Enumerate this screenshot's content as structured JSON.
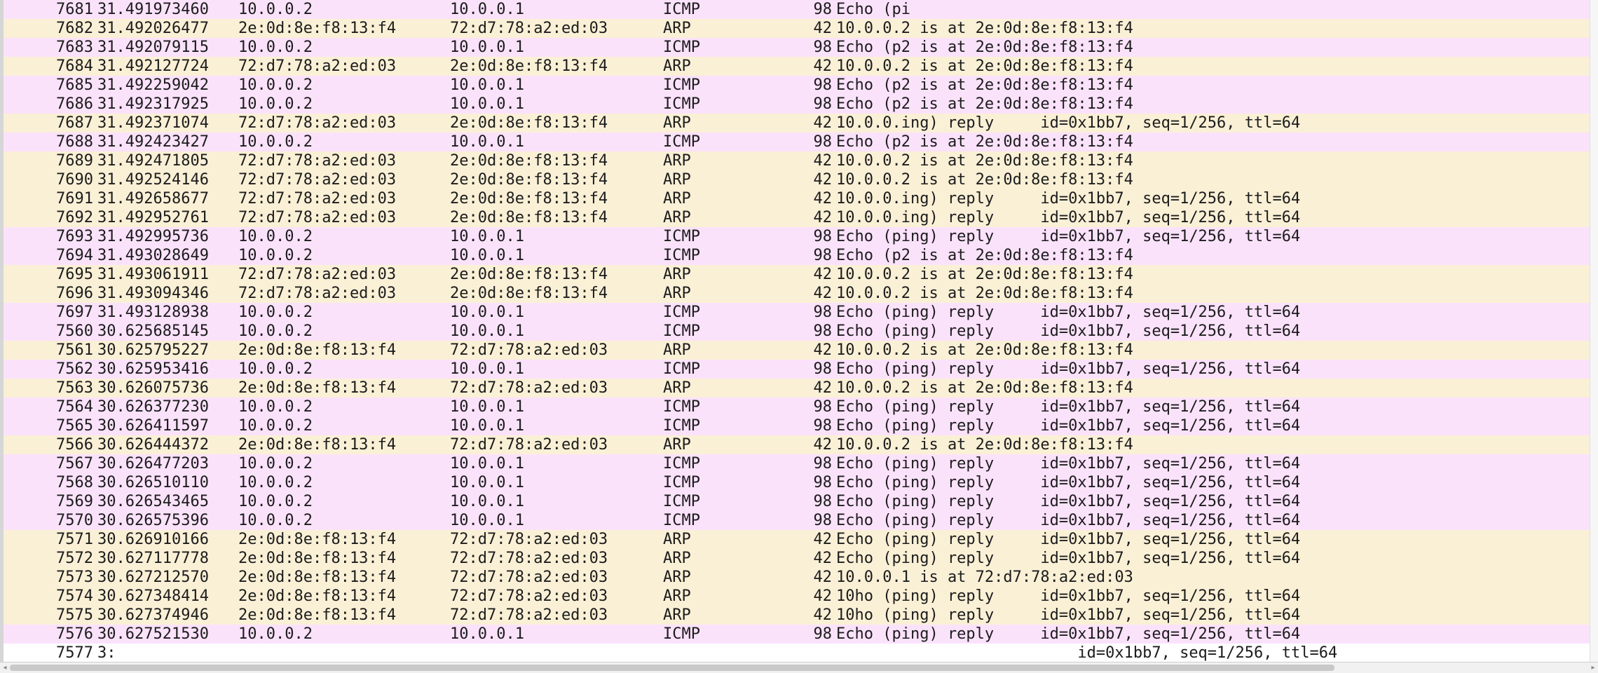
{
  "packets": [
    {
      "no": "7681",
      "time": "31.491973460",
      "src": "10.0.0.2",
      "dst": "10.0.0.1",
      "proto": "ICMP",
      "len": "98",
      "info": "Echo (pi",
      "proto_class": "icmp"
    },
    {
      "no": "7682",
      "time": "31.492026477",
      "src": "2e:0d:8e:f8:13:f4",
      "dst": "72:d7:78:a2:ed:03",
      "proto": "ARP",
      "len": "42",
      "info": "10.0.0.2 is at 2e:0d:8e:f8:13:f4",
      "proto_class": "arp"
    },
    {
      "no": "7683",
      "time": "31.492079115",
      "src": "10.0.0.2",
      "dst": "10.0.0.1",
      "proto": "ICMP",
      "len": "98",
      "info": "Echo (p2 is at 2e:0d:8e:f8:13:f4",
      "proto_class": "icmp"
    },
    {
      "no": "7684",
      "time": "31.492127724",
      "src": "72:d7:78:a2:ed:03",
      "dst": "2e:0d:8e:f8:13:f4",
      "proto": "ARP",
      "len": "42",
      "info": "10.0.0.2 is at 2e:0d:8e:f8:13:f4",
      "proto_class": "arp"
    },
    {
      "no": "7685",
      "time": "31.492259042",
      "src": "10.0.0.2",
      "dst": "10.0.0.1",
      "proto": "ICMP",
      "len": "98",
      "info": "Echo (p2 is at 2e:0d:8e:f8:13:f4",
      "proto_class": "icmp"
    },
    {
      "no": "7686",
      "time": "31.492317925",
      "src": "10.0.0.2",
      "dst": "10.0.0.1",
      "proto": "ICMP",
      "len": "98",
      "info": "Echo (p2 is at 2e:0d:8e:f8:13:f4",
      "proto_class": "icmp"
    },
    {
      "no": "7687",
      "time": "31.492371074",
      "src": "72:d7:78:a2:ed:03",
      "dst": "2e:0d:8e:f8:13:f4",
      "proto": "ARP",
      "len": "42",
      "info": "10.0.0.ing) reply     id=0x1bb7, seq=1/256, ttl=64",
      "proto_class": "arp"
    },
    {
      "no": "7688",
      "time": "31.492423427",
      "src": "10.0.0.2",
      "dst": "10.0.0.1",
      "proto": "ICMP",
      "len": "98",
      "info": "Echo (p2 is at 2e:0d:8e:f8:13:f4",
      "proto_class": "icmp"
    },
    {
      "no": "7689",
      "time": "31.492471805",
      "src": "72:d7:78:a2:ed:03",
      "dst": "2e:0d:8e:f8:13:f4",
      "proto": "ARP",
      "len": "42",
      "info": "10.0.0.2 is at 2e:0d:8e:f8:13:f4",
      "proto_class": "arp"
    },
    {
      "no": "7690",
      "time": "31.492524146",
      "src": "72:d7:78:a2:ed:03",
      "dst": "2e:0d:8e:f8:13:f4",
      "proto": "ARP",
      "len": "42",
      "info": "10.0.0.2 is at 2e:0d:8e:f8:13:f4",
      "proto_class": "arp"
    },
    {
      "no": "7691",
      "time": "31.492658677",
      "src": "72:d7:78:a2:ed:03",
      "dst": "2e:0d:8e:f8:13:f4",
      "proto": "ARP",
      "len": "42",
      "info": "10.0.0.ing) reply     id=0x1bb7, seq=1/256, ttl=64",
      "proto_class": "arp"
    },
    {
      "no": "7692",
      "time": "31.492952761",
      "src": "72:d7:78:a2:ed:03",
      "dst": "2e:0d:8e:f8:13:f4",
      "proto": "ARP",
      "len": "42",
      "info": "10.0.0.ing) reply     id=0x1bb7, seq=1/256, ttl=64",
      "proto_class": "arp"
    },
    {
      "no": "7693",
      "time": "31.492995736",
      "src": "10.0.0.2",
      "dst": "10.0.0.1",
      "proto": "ICMP",
      "len": "98",
      "info": "Echo (ping) reply     id=0x1bb7, seq=1/256, ttl=64",
      "proto_class": "icmp"
    },
    {
      "no": "7694",
      "time": "31.493028649",
      "src": "10.0.0.2",
      "dst": "10.0.0.1",
      "proto": "ICMP",
      "len": "98",
      "info": "Echo (p2 is at 2e:0d:8e:f8:13:f4",
      "proto_class": "icmp"
    },
    {
      "no": "7695",
      "time": "31.493061911",
      "src": "72:d7:78:a2:ed:03",
      "dst": "2e:0d:8e:f8:13:f4",
      "proto": "ARP",
      "len": "42",
      "info": "10.0.0.2 is at 2e:0d:8e:f8:13:f4",
      "proto_class": "arp"
    },
    {
      "no": "7696",
      "time": "31.493094346",
      "src": "72:d7:78:a2:ed:03",
      "dst": "2e:0d:8e:f8:13:f4",
      "proto": "ARP",
      "len": "42",
      "info": "10.0.0.2 is at 2e:0d:8e:f8:13:f4",
      "proto_class": "arp"
    },
    {
      "no": "7697",
      "time": "31.493128938",
      "src": "10.0.0.2",
      "dst": "10.0.0.1",
      "proto": "ICMP",
      "len": "98",
      "info": "Echo (ping) reply     id=0x1bb7, seq=1/256, ttl=64",
      "proto_class": "icmp"
    },
    {
      "no": "7560",
      "time": "30.625685145",
      "src": "10.0.0.2",
      "dst": "10.0.0.1",
      "proto": "ICMP",
      "len": "98",
      "info": "Echo (ping) reply     id=0x1bb7, seq=1/256, ttl=64",
      "proto_class": "icmp"
    },
    {
      "no": "7561",
      "time": "30.625795227",
      "src": "2e:0d:8e:f8:13:f4",
      "dst": "72:d7:78:a2:ed:03",
      "proto": "ARP",
      "len": "42",
      "info": "10.0.0.2 is at 2e:0d:8e:f8:13:f4",
      "proto_class": "arp"
    },
    {
      "no": "7562",
      "time": "30.625953416",
      "src": "10.0.0.2",
      "dst": "10.0.0.1",
      "proto": "ICMP",
      "len": "98",
      "info": "Echo (ping) reply     id=0x1bb7, seq=1/256, ttl=64",
      "proto_class": "icmp"
    },
    {
      "no": "7563",
      "time": "30.626075736",
      "src": "2e:0d:8e:f8:13:f4",
      "dst": "72:d7:78:a2:ed:03",
      "proto": "ARP",
      "len": "42",
      "info": "10.0.0.2 is at 2e:0d:8e:f8:13:f4",
      "proto_class": "arp"
    },
    {
      "no": "7564",
      "time": "30.626377230",
      "src": "10.0.0.2",
      "dst": "10.0.0.1",
      "proto": "ICMP",
      "len": "98",
      "info": "Echo (ping) reply     id=0x1bb7, seq=1/256, ttl=64",
      "proto_class": "icmp"
    },
    {
      "no": "7565",
      "time": "30.626411597",
      "src": "10.0.0.2",
      "dst": "10.0.0.1",
      "proto": "ICMP",
      "len": "98",
      "info": "Echo (ping) reply     id=0x1bb7, seq=1/256, ttl=64",
      "proto_class": "icmp"
    },
    {
      "no": "7566",
      "time": "30.626444372",
      "src": "2e:0d:8e:f8:13:f4",
      "dst": "72:d7:78:a2:ed:03",
      "proto": "ARP",
      "len": "42",
      "info": "10.0.0.2 is at 2e:0d:8e:f8:13:f4",
      "proto_class": "arp"
    },
    {
      "no": "7567",
      "time": "30.626477203",
      "src": "10.0.0.2",
      "dst": "10.0.0.1",
      "proto": "ICMP",
      "len": "98",
      "info": "Echo (ping) reply     id=0x1bb7, seq=1/256, ttl=64",
      "proto_class": "icmp"
    },
    {
      "no": "7568",
      "time": "30.626510110",
      "src": "10.0.0.2",
      "dst": "10.0.0.1",
      "proto": "ICMP",
      "len": "98",
      "info": "Echo (ping) reply     id=0x1bb7, seq=1/256, ttl=64",
      "proto_class": "icmp"
    },
    {
      "no": "7569",
      "time": "30.626543465",
      "src": "10.0.0.2",
      "dst": "10.0.0.1",
      "proto": "ICMP",
      "len": "98",
      "info": "Echo (ping) reply     id=0x1bb7, seq=1/256, ttl=64",
      "proto_class": "icmp"
    },
    {
      "no": "7570",
      "time": "30.626575396",
      "src": "10.0.0.2",
      "dst": "10.0.0.1",
      "proto": "ICMP",
      "len": "98",
      "info": "Echo (ping) reply     id=0x1bb7, seq=1/256, ttl=64",
      "proto_class": "icmp"
    },
    {
      "no": "7571",
      "time": "30.626910166",
      "src": "2e:0d:8e:f8:13:f4",
      "dst": "72:d7:78:a2:ed:03",
      "proto": "ARP",
      "len": "42",
      "info": "Echo (ping) reply     id=0x1bb7, seq=1/256, ttl=64",
      "proto_class": "arp"
    },
    {
      "no": "7572",
      "time": "30.627117778",
      "src": "2e:0d:8e:f8:13:f4",
      "dst": "72:d7:78:a2:ed:03",
      "proto": "ARP",
      "len": "42",
      "info": "Echo (ping) reply     id=0x1bb7, seq=1/256, ttl=64",
      "proto_class": "arp"
    },
    {
      "no": "7573",
      "time": "30.627212570",
      "src": "2e:0d:8e:f8:13:f4",
      "dst": "72:d7:78:a2:ed:03",
      "proto": "ARP",
      "len": "42",
      "info": "10.0.0.1 is at 72:d7:78:a2:ed:03",
      "proto_class": "arp"
    },
    {
      "no": "7574",
      "time": "30.627348414",
      "src": "2e:0d:8e:f8:13:f4",
      "dst": "72:d7:78:a2:ed:03",
      "proto": "ARP",
      "len": "42",
      "info": "10ho (ping) reply     id=0x1bb7, seq=1/256, ttl=64",
      "proto_class": "arp"
    },
    {
      "no": "7575",
      "time": "30.627374946",
      "src": "2e:0d:8e:f8:13:f4",
      "dst": "72:d7:78:a2:ed:03",
      "proto": "ARP",
      "len": "42",
      "info": "10ho (ping) reply     id=0x1bb7, seq=1/256, ttl=64",
      "proto_class": "arp"
    },
    {
      "no": "7576",
      "time": "30.627521530",
      "src": "10.0.0.2",
      "dst": "10.0.0.1",
      "proto": "ICMP",
      "len": "98",
      "info": "Echo (ping) reply     id=0x1bb7, seq=1/256, ttl=64",
      "proto_class": "icmp"
    },
    {
      "no": "7577",
      "time": "3:",
      "src": "",
      "dst": "",
      "proto": "",
      "len": "",
      "info": "                          id=0x1bb7, seq=1/256, ttl=64",
      "proto_class": "partial"
    }
  ],
  "colors": {
    "icmp_row": "#fbe2fb",
    "arp_row": "#faf0d6",
    "text": "#1c1c1c"
  },
  "scrollbar": {
    "left_arrow_icon": "chevron-left-icon",
    "right_arrow_icon": "chevron-right-icon"
  }
}
